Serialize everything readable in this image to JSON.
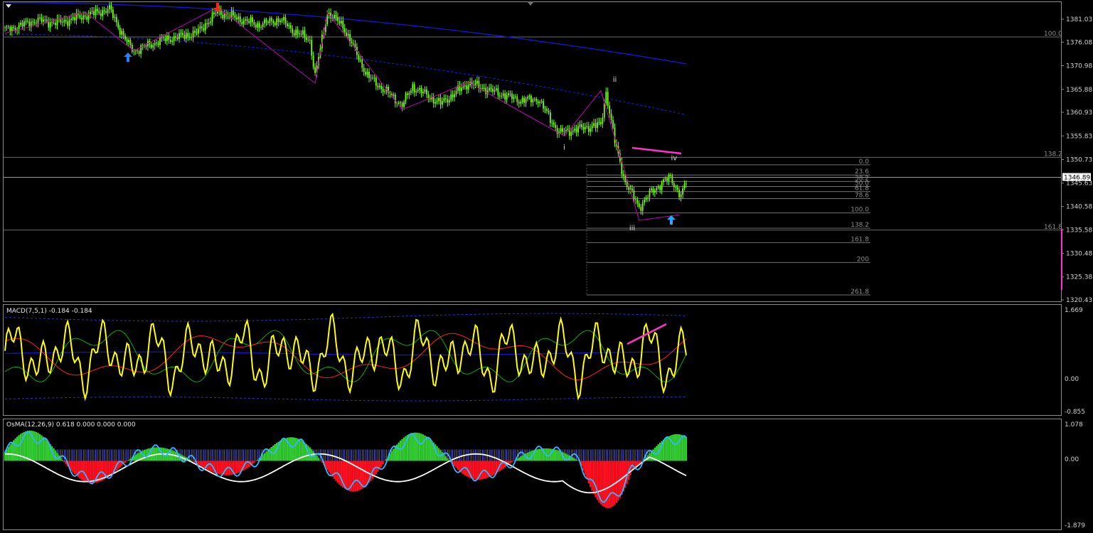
{
  "colors": {
    "background": "#000000",
    "candle": "#7CFC00",
    "ma_line": "#1515e0",
    "envelope": "#1a1aff",
    "zigzag": "#c000c0",
    "highlight": "#ff33cc",
    "macd_main": "#ffff00",
    "macd_signal": "#ff2020",
    "macd_third": "#00c000",
    "osma_up": "#33cc33",
    "osma_down": "#ff1020",
    "osma_line1": "#ffffff",
    "osma_line2": "#33b5ff",
    "fib_line": "#707070",
    "current_price_bg": "#ffffff"
  },
  "main_panel": {
    "price_axis": [
      "1381.03",
      "1376.08",
      "1370.98",
      "1365.88",
      "1360.93",
      "1355.83",
      "1350.73",
      "1345.63",
      "1340.58",
      "1335.58",
      "1330.48",
      "1325.38",
      "1320.43"
    ],
    "current_price": "1346.89",
    "right_levels": [
      {
        "label": "100.0",
        "price": 1377.2
      },
      {
        "label": "138.2",
        "price": 1351.2
      },
      {
        "label": "161.8",
        "price": 1335.5
      }
    ],
    "fib_levels": [
      {
        "label": "0.0",
        "price": 1349.6
      },
      {
        "label": "23.6",
        "price": 1347.4
      },
      {
        "label": "38.2",
        "price": 1346.0
      },
      {
        "label": "50.0",
        "price": 1344.9
      },
      {
        "label": "61.8",
        "price": 1343.8
      },
      {
        "label": "78.6",
        "price": 1342.3
      },
      {
        "label": "100.0",
        "price": 1339.2
      },
      {
        "label": "138.2",
        "price": 1335.9
      },
      {
        "label": "161.8",
        "price": 1332.8
      },
      {
        "label": "200",
        "price": 1328.5
      },
      {
        "label": "261.8",
        "price": 1321.5
      }
    ],
    "wave_labels": [
      {
        "label": "ii",
        "bar": 350,
        "price": 1367.5
      },
      {
        "label": "i",
        "bar": 321,
        "price": 1352.9
      },
      {
        "label": "iv",
        "bar": 384,
        "price": 1350.6
      },
      {
        "label": "iii",
        "bar": 360,
        "price": 1335.5
      }
    ]
  },
  "macd_panel": {
    "title": "MACD(7,5,1) -0.184 -0.184",
    "axis": [
      "1.669",
      "0.00",
      "-0.855"
    ]
  },
  "osma_panel": {
    "title": "OsMA(12,26,9) 0.618 0.000 0.000 0.000",
    "axis": [
      "1.078",
      "0.00",
      "-1.879"
    ]
  }
}
